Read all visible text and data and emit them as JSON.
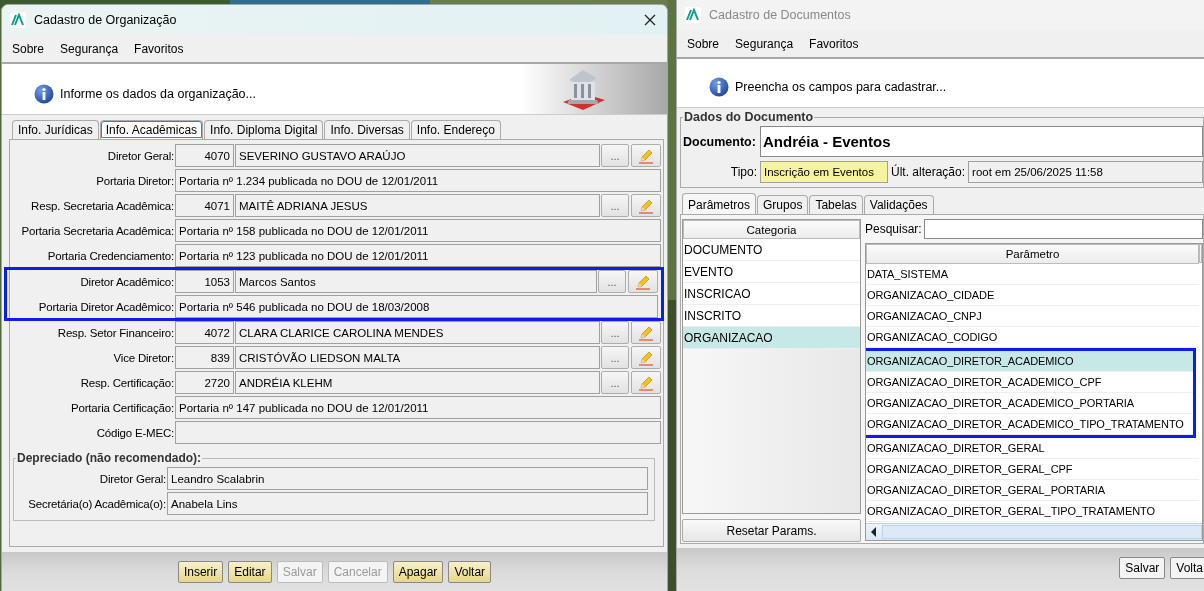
{
  "left_window": {
    "title": "Cadastro de Organização",
    "active": true,
    "menu": [
      {
        "label": "Sobre"
      },
      {
        "label": "Segurança"
      },
      {
        "label": "Favoritos"
      }
    ],
    "info": "Informe os dados da organização...",
    "tabs": [
      {
        "label": "Info. Jurídicas",
        "selected": false
      },
      {
        "label": "Info. Acadêmicas",
        "selected": true
      },
      {
        "label": "Info. Diploma Digital",
        "selected": false
      },
      {
        "label": "Info. Diversas",
        "selected": false
      },
      {
        "label": "Info. Endereço",
        "selected": false
      }
    ],
    "fields": [
      {
        "kind": "lookup",
        "label": "Diretor Geral:",
        "code": "4070",
        "value": "SEVERINO GUSTAVO ARAÚJO",
        "highlighted": false
      },
      {
        "kind": "text",
        "label": "Portaria Diretor:",
        "value": "Portaria nº 1.234 publicada no DOU de 12/01/2011",
        "highlighted": false
      },
      {
        "kind": "lookup",
        "label": "Resp. Secretaria Acadêmica:",
        "code": "4071",
        "value": "MAITÊ ADRIANA JESUS",
        "highlighted": false
      },
      {
        "kind": "text",
        "label": "Portaria Secretaria Acadêmica:",
        "value": "Portaria nº 158 publicada no DOU de 12/01/2011",
        "highlighted": false
      },
      {
        "kind": "text",
        "label": "Portaria Credenciamento:",
        "value": "Portaria nº 123 publicada no DOU de 12/01/2011",
        "highlighted": false
      },
      {
        "kind": "lookup",
        "label": "Diretor Acadêmico:",
        "code": "1053",
        "value": "Marcos Santos",
        "highlighted": true
      },
      {
        "kind": "text",
        "label": "Portaria Diretor Acadêmico:",
        "value": "Portaria nº 546 publicada no DOU de 18/03/2008",
        "highlighted": true
      },
      {
        "kind": "lookup",
        "label": "Resp. Setor Financeiro:",
        "code": "4072",
        "value": "CLARA CLARICE CAROLINA MENDES",
        "highlighted": false
      },
      {
        "kind": "lookup",
        "label": "Vice Diretor:",
        "code": "839",
        "value": "CRISTÓVÃO LIEDSON MALTA",
        "highlighted": false
      },
      {
        "kind": "lookup",
        "label": "Resp. Certificação:",
        "code": "2720",
        "value": "ANDRÉIA KLEHM",
        "highlighted": false
      },
      {
        "kind": "text",
        "label": "Portaria Certificação:",
        "value": "Portaria nº 147 publicada no DOU de 12/01/2011",
        "highlighted": false
      },
      {
        "kind": "text",
        "label": "Código E-MEC:",
        "highlighted": false
      }
    ],
    "lookup_button": "...",
    "deprecated": {
      "title": "Depreciado (não recomendado):",
      "fields": [
        {
          "label": "Diretor Geral:",
          "value": "Leandro Scalabrin"
        },
        {
          "label": "Secretária(o) Acadêmica(o):",
          "value": "Anabela Lins"
        }
      ]
    },
    "buttons": [
      {
        "label": "Inserir",
        "disabled": false
      },
      {
        "label": "Editar",
        "disabled": false
      },
      {
        "label": "Salvar",
        "disabled": true
      },
      {
        "label": "Cancelar",
        "disabled": true
      },
      {
        "label": "Apagar",
        "disabled": false
      },
      {
        "label": "Voltar",
        "disabled": false
      }
    ]
  },
  "right_window": {
    "title": "Cadastro de Documentos",
    "active": false,
    "menu": [
      {
        "label": "Sobre"
      },
      {
        "label": "Segurança"
      },
      {
        "label": "Favoritos"
      }
    ],
    "info": "Preencha os campos para cadastrar...",
    "document_group": {
      "title": "Dados do Documento",
      "document_label": "Documento:",
      "document": "Andréia - Eventos",
      "type_label": "Tipo:",
      "type": "Inscrição em Eventos",
      "changed_label": "Últ. alteração:",
      "changed": "root em 25/06/2025 11:58"
    },
    "tabs": [
      {
        "label": "Parâmetros",
        "selected": true
      },
      {
        "label": "Grupos",
        "selected": false
      },
      {
        "label": "Tabelas",
        "selected": false
      },
      {
        "label": "Validações",
        "selected": false
      }
    ],
    "categories": {
      "header": "Categoria",
      "items": [
        {
          "label": "DOCUMENTO",
          "selected": false
        },
        {
          "label": "EVENTO",
          "selected": false
        },
        {
          "label": "INSCRICAO",
          "selected": false
        },
        {
          "label": "INSCRITO",
          "selected": false
        },
        {
          "label": "ORGANIZACAO",
          "selected": true
        }
      ],
      "reset_button": "Resetar Params."
    },
    "search_label": "Pesquisar:",
    "parameters": {
      "header": "Parâmetro",
      "rows": [
        {
          "label": "DATA_SISTEMA",
          "selected": false,
          "highlighted": false
        },
        {
          "label": "ORGANIZACAO_CIDADE",
          "selected": false,
          "highlighted": false
        },
        {
          "label": "ORGANIZACAO_CNPJ",
          "selected": false,
          "highlighted": false
        },
        {
          "label": "ORGANIZACAO_CODIGO",
          "selected": false,
          "highlighted": false
        },
        {
          "label": "ORGANIZACAO_DIRETOR_ACADEMICO",
          "selected": true,
          "highlighted": true
        },
        {
          "label": "ORGANIZACAO_DIRETOR_ACADEMICO_CPF",
          "selected": false,
          "highlighted": true
        },
        {
          "label": "ORGANIZACAO_DIRETOR_ACADEMICO_PORTARIA",
          "selected": false,
          "highlighted": true
        },
        {
          "label": "ORGANIZACAO_DIRETOR_ACADEMICO_TIPO_TRATAMENTO",
          "selected": false,
          "highlighted": true
        },
        {
          "label": "ORGANIZACAO_DIRETOR_GERAL",
          "selected": false,
          "highlighted": false
        },
        {
          "label": "ORGANIZACAO_DIRETOR_GERAL_CPF",
          "selected": false,
          "highlighted": false
        },
        {
          "label": "ORGANIZACAO_DIRETOR_GERAL_PORTARIA",
          "selected": false,
          "highlighted": false
        },
        {
          "label": "ORGANIZACAO_DIRETOR_GERAL_TIPO_TRATAMENTO",
          "selected": false,
          "highlighted": false
        }
      ]
    },
    "buttons": [
      {
        "label": "Salvar",
        "disabled": false
      },
      {
        "label": "Volta",
        "disabled": false
      }
    ]
  }
}
